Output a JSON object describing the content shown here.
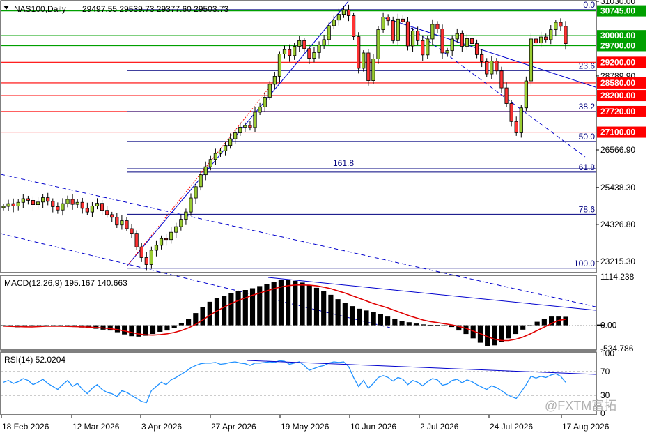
{
  "header": {
    "symbol": "NAS100,Daily",
    "ohlc": "29497.55 29539.73 29377.60 29503.73"
  },
  "price_axis_labels": [
    "31030.00",
    "28789.90",
    "26566.90",
    "25438.30",
    "24326.80",
    "23215.30"
  ],
  "price_boxes": [
    {
      "label": "30745.00",
      "value": 30745,
      "kind": "support-resistance",
      "color": "#00a000"
    },
    {
      "label": "30000.00",
      "value": 30000,
      "kind": "support-resistance",
      "color": "#00a000"
    },
    {
      "label": "29700.00",
      "value": 29700,
      "kind": "support-resistance",
      "color": "#00a000"
    },
    {
      "label": "29200.00",
      "value": 29200,
      "kind": "resistance",
      "color": "#ff0000"
    },
    {
      "label": "28580.00",
      "value": 28580,
      "kind": "resistance",
      "color": "#ff0000"
    },
    {
      "label": "28200.00",
      "value": 28200,
      "kind": "resistance",
      "color": "#ff0000"
    },
    {
      "label": "27720.00",
      "value": 27720,
      "kind": "resistance",
      "color": "#ff0000"
    },
    {
      "label": "27100.00",
      "value": 27100,
      "kind": "resistance",
      "color": "#ff0000"
    }
  ],
  "fib_levels": [
    {
      "label": "0.0",
      "value": 30780
    },
    {
      "label": "23.6",
      "value": 28950
    },
    {
      "label": "38.2",
      "value": 27720
    },
    {
      "label": "50.0",
      "value": 26820
    },
    {
      "label": "61.8",
      "value": 25900
    },
    {
      "label": "78.6",
      "value": 24630
    },
    {
      "label": "100.0",
      "value": 23010
    }
  ],
  "fib_ext_label": "161.8",
  "macd": {
    "title": "MACD(12,26,9) 195.167 140.663",
    "axis_labels": [
      "1114.238",
      "0.00",
      "-534.786"
    ]
  },
  "rsi": {
    "title": "RSI(14) 52.0204",
    "axis_labels": [
      "100",
      "70",
      "30",
      "0"
    ]
  },
  "x_axis_labels": [
    "18 Feb 2026",
    "12 Mar 2026",
    "3 Apr 2026",
    "27 Apr 2026",
    "19 May 2026",
    "10 Jun 2026",
    "2 Jul 2026",
    "24 Jul 2026",
    "17 Aug 2026"
  ],
  "watermark": "@FXTM富拓",
  "colors": {
    "bull": "#9acd32",
    "bear": "#ff3333",
    "candle_outline": "#000000",
    "macd_hist": "#000000",
    "macd_signal": "#e00000",
    "rsi_line": "#1e90ff",
    "trendline": "#0000cd",
    "fib": "#00007f"
  },
  "chart_data": [
    {
      "type": "candlestick",
      "title": "NAS100,Daily",
      "x_range": [
        "18 Feb 2026",
        "19 Aug 2026"
      ],
      "ylim": [
        22900,
        31030
      ],
      "series": [
        {
          "name": "NAS100",
          "close": [
            24870,
            24950,
            24880,
            24990,
            25100,
            25050,
            24920,
            25000,
            25130,
            25020,
            24860,
            24760,
            24950,
            25080,
            24930,
            24990,
            24810,
            24700,
            24880,
            24960,
            24750,
            24620,
            24540,
            24310,
            24440,
            24200,
            24060,
            23650,
            23330,
            23120,
            23550,
            23700,
            23900,
            23870,
            24090,
            24260,
            24480,
            24700,
            25120,
            25460,
            25820,
            26060,
            26280,
            26460,
            26540,
            26700,
            26900,
            27080,
            27250,
            27300,
            27240,
            27700,
            27860,
            28150,
            28540,
            28780,
            29450,
            29580,
            29400,
            29680,
            29850,
            29610,
            29320,
            29490,
            29720,
            29880,
            30300,
            30470,
            30640,
            30780,
            30600,
            29970,
            29020,
            29480,
            28650,
            29300,
            30180,
            30560,
            30450,
            29850,
            30500,
            30420,
            29690,
            30140,
            29850,
            29420,
            29900,
            30340,
            30200,
            29480,
            29550,
            29900,
            30060,
            29680,
            29910,
            29760,
            29430,
            29220,
            28850,
            29240,
            28940,
            28430,
            27960,
            27420,
            27080,
            27830,
            28640,
            29900,
            29780,
            29960,
            29880,
            30180,
            30400,
            30280,
            29760
          ]
        }
      ],
      "note_lines": {
        "support_resistance": [
          30745,
          30000,
          29700,
          29200,
          28580,
          28200,
          27720,
          27100
        ]
      }
    },
    {
      "type": "bar",
      "title": "MACD(12,26,9) 195.167 140.663",
      "ylim": [
        -534.786,
        1114.238
      ],
      "series": [
        {
          "name": "MACD",
          "values": [
            -20,
            -30,
            -45,
            -35,
            -25,
            -10,
            -5,
            -15,
            -25,
            -30,
            -40,
            -50,
            -60,
            -80,
            -100,
            -120,
            -160,
            -210,
            -250,
            -260,
            -240,
            -200,
            -150,
            -120,
            -60,
            50,
            150,
            280,
            420,
            540,
            620,
            680,
            740,
            780,
            810,
            850,
            900,
            950,
            1000,
            1040,
            1050,
            1020,
            980,
            920,
            860,
            780,
            700,
            600,
            520,
            440,
            380,
            340,
            300,
            250,
            200,
            150,
            100,
            70,
            40,
            20,
            10,
            5,
            0,
            -40,
            -120,
            -200,
            -300,
            -400,
            -480,
            -460,
            -380,
            -300,
            -200,
            -100,
            0,
            80,
            150,
            200,
            200,
            195
          ]
        },
        {
          "name": "Signal",
          "values": [
            -20,
            -25,
            -30,
            -35,
            -38,
            -30,
            -22,
            -20,
            -22,
            -25,
            -30,
            -36,
            -42,
            -52,
            -62,
            -78,
            -100,
            -130,
            -165,
            -200,
            -220,
            -225,
            -215,
            -195,
            -165,
            -120,
            -60,
            20,
            120,
            230,
            330,
            420,
            500,
            570,
            630,
            690,
            740,
            790,
            840,
            880,
            910,
            925,
            925,
            920,
            905,
            875,
            840,
            790,
            740,
            680,
            620,
            560,
            500,
            450,
            400,
            340,
            280,
            220,
            170,
            120,
            85,
            60,
            35,
            10,
            -25,
            -70,
            -130,
            -190,
            -260,
            -320,
            -350,
            -350,
            -320,
            -270,
            -200,
            -120,
            -40,
            40,
            110,
            140
          ]
        }
      ]
    },
    {
      "type": "line",
      "title": "RSI(14) 52.0204",
      "ylim": [
        0,
        100
      ],
      "series": [
        {
          "name": "RSI(14)",
          "values": [
            52,
            55,
            50,
            53,
            58,
            55,
            48,
            52,
            57,
            50,
            45,
            40,
            48,
            55,
            45,
            50,
            40,
            33,
            42,
            48,
            40,
            35,
            33,
            28,
            38,
            35,
            30,
            25,
            20,
            18,
            38,
            45,
            52,
            48,
            56,
            60,
            65,
            70,
            76,
            80,
            83,
            84,
            84,
            85,
            82,
            83,
            85,
            86,
            84,
            83,
            80,
            84,
            84,
            85,
            86,
            85,
            88,
            87,
            82,
            84,
            86,
            80,
            72,
            75,
            78,
            80,
            84,
            86,
            85,
            86,
            78,
            60,
            45,
            55,
            42,
            50,
            60,
            63,
            60,
            54,
            60,
            57,
            48,
            55,
            52,
            46,
            53,
            58,
            56,
            47,
            49,
            55,
            57,
            51,
            56,
            53,
            48,
            44,
            40,
            46,
            43,
            38,
            32,
            28,
            25,
            36,
            48,
            62,
            59,
            62,
            60,
            64,
            66,
            62,
            52
          ]
        }
      ],
      "levels": [
        70,
        30
      ]
    }
  ]
}
